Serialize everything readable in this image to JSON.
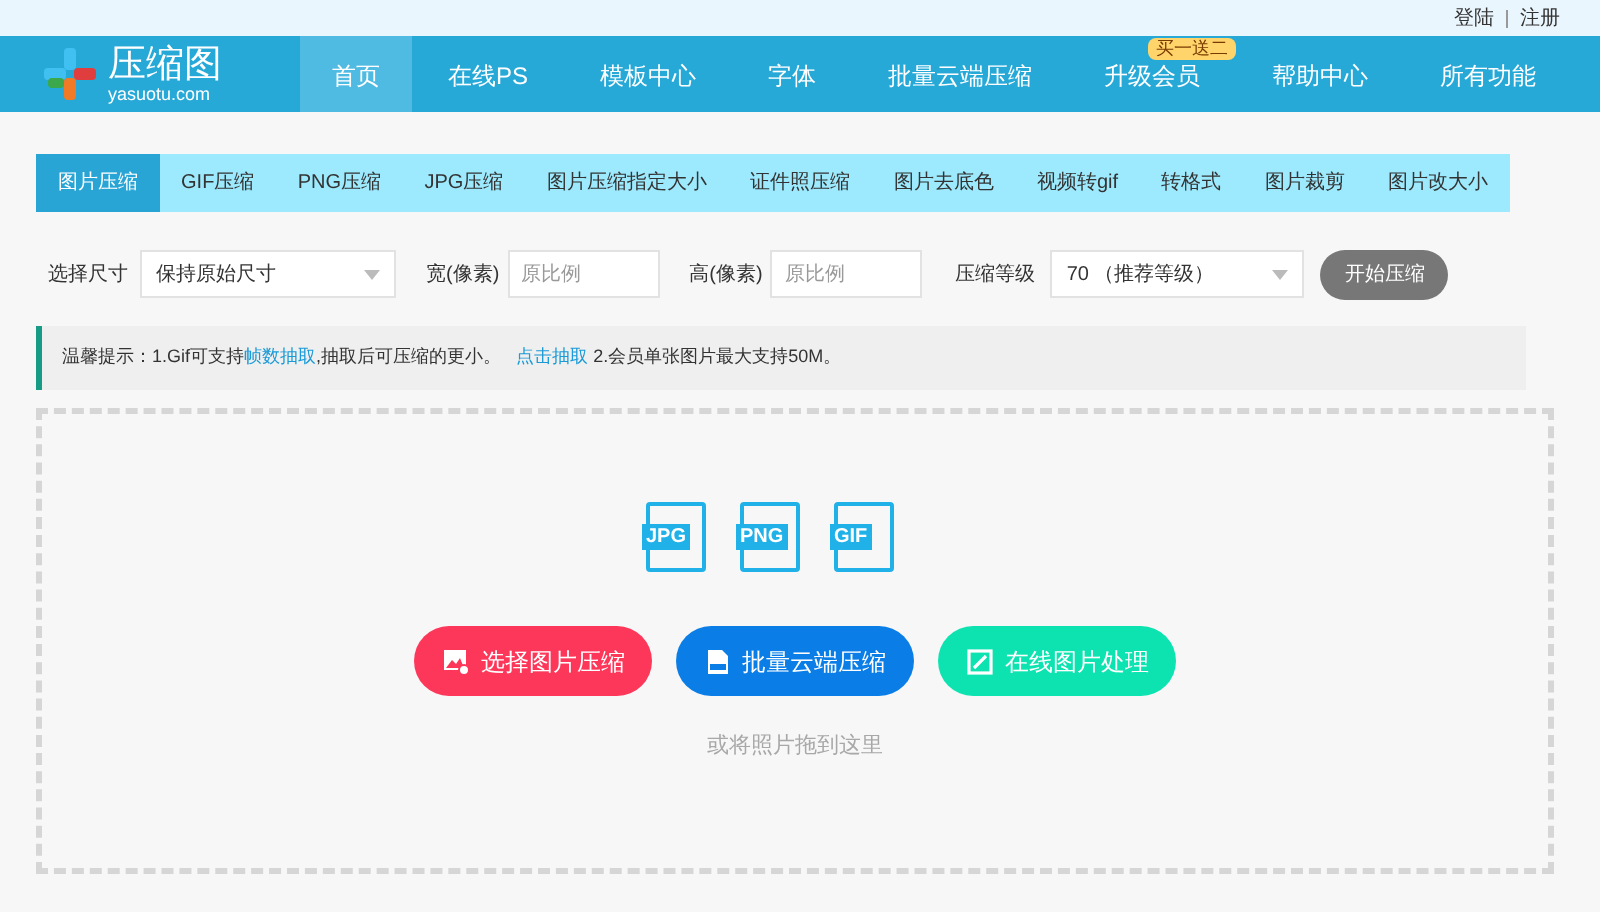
{
  "top_links": [
    "登陆",
    "注册"
  ],
  "logo": {
    "name": "压缩图",
    "domain": "yasuotu.com"
  },
  "nav": [
    {
      "label": "首页",
      "selected": true
    },
    {
      "label": "在线PS",
      "selected": false
    },
    {
      "label": "模板中心",
      "selected": false
    },
    {
      "label": "字体",
      "selected": false
    },
    {
      "label": "批量云端压缩",
      "selected": false
    },
    {
      "label": "升级会员",
      "selected": false,
      "badge": "买一送二"
    },
    {
      "label": "帮助中心",
      "selected": false
    },
    {
      "label": "所有功能",
      "selected": false
    }
  ],
  "tabs": [
    {
      "label": "图片压缩",
      "selected": true
    },
    {
      "label": "GIF压缩",
      "selected": false
    },
    {
      "label": "PNG压缩",
      "selected": false
    },
    {
      "label": "JPG压缩",
      "selected": false
    },
    {
      "label": "图片压缩指定大小",
      "selected": false
    },
    {
      "label": "证件照压缩",
      "selected": false
    },
    {
      "label": "图片去底色",
      "selected": false
    },
    {
      "label": "视频转gif",
      "selected": false
    },
    {
      "label": "转格式",
      "selected": false
    },
    {
      "label": "图片裁剪",
      "selected": false
    },
    {
      "label": "图片改大小",
      "selected": false
    }
  ],
  "options": {
    "size_label": "选择尺寸",
    "size_value": "保持原始尺寸",
    "width_label": "宽(像素)",
    "width_placeholder": "原比例",
    "height_label": "高(像素)",
    "height_placeholder": "原比例",
    "level_label": "压缩等级",
    "level_value": "70 （推荐等级）",
    "start_button": "开始压缩"
  },
  "tip": {
    "prefix": "温馨提示：1.Gif可支持",
    "link1": "帧数抽取",
    "middle": ",抽取后可压缩的更小。",
    "link2": "点击抽取",
    "suffix": "2.会员单张图片最大支持50M。"
  },
  "file_types": [
    "JPG",
    "PNG",
    "GIF"
  ],
  "actions": [
    {
      "label": "选择图片压缩",
      "kind": "upload",
      "color": "#fd3759"
    },
    {
      "label": "批量云端压缩",
      "kind": "batch",
      "color": "#0a7ee6"
    },
    {
      "label": "在线图片处理",
      "kind": "edit",
      "color": "#0de3b0"
    }
  ],
  "drop_hint": "或将照片拖到这里"
}
